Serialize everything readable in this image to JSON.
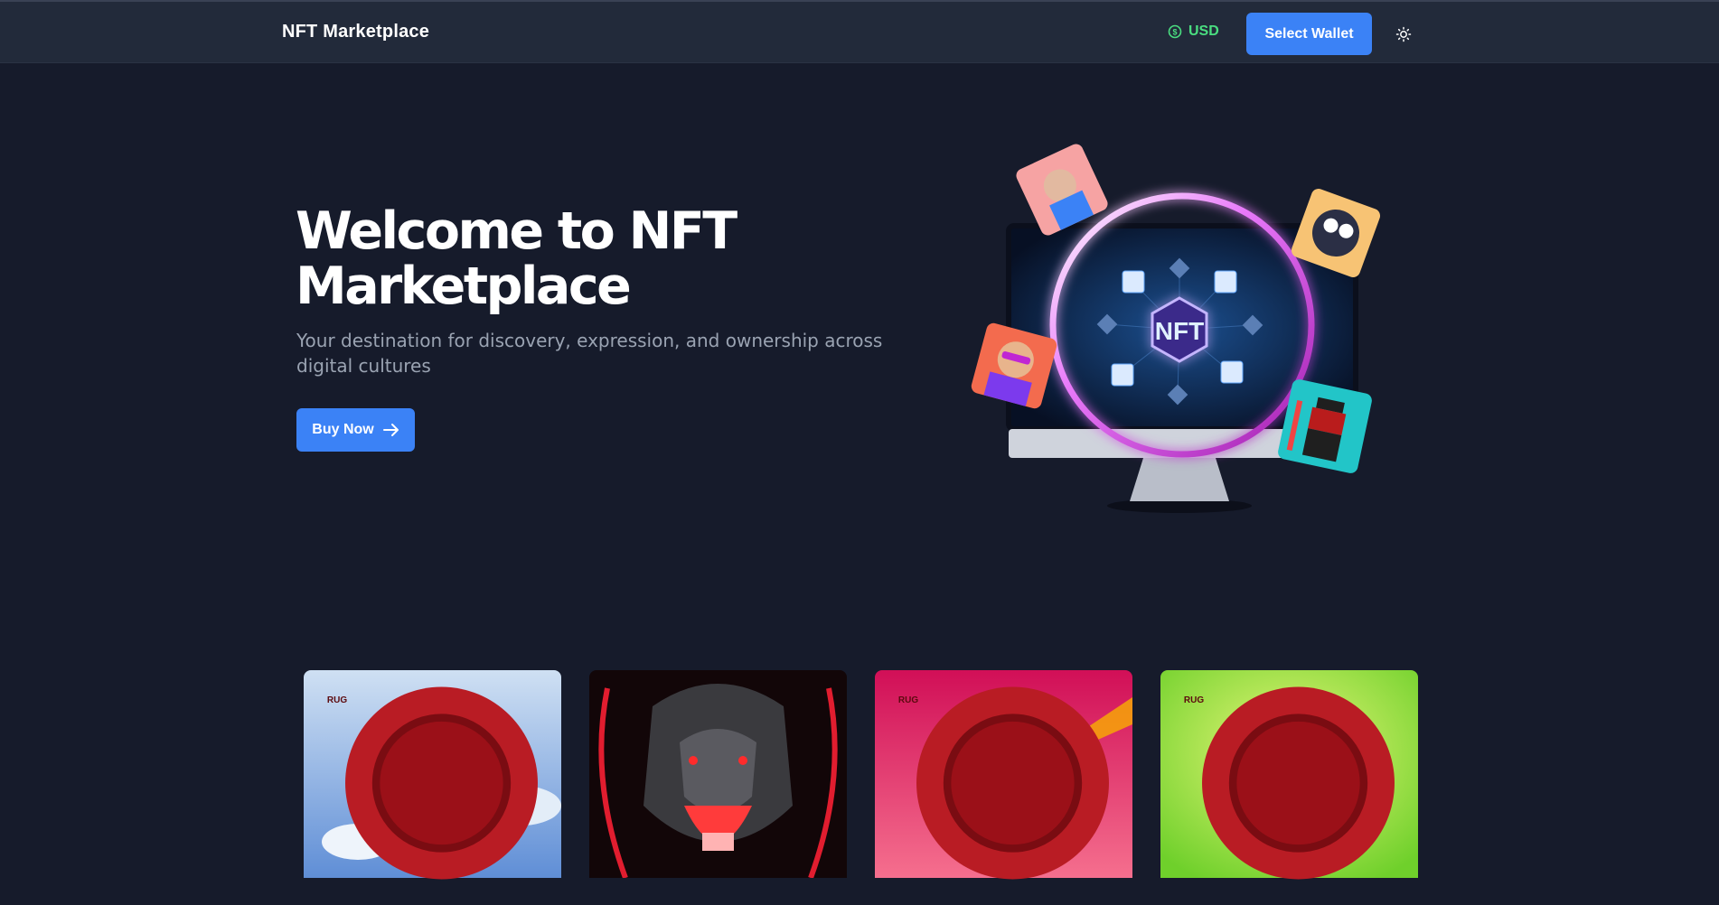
{
  "nav": {
    "brand": "NFT Marketplace",
    "currency": "USD",
    "wallet_button": "Select Wallet",
    "theme_icon": "sun-icon"
  },
  "hero": {
    "title": "Welcome to NFT Marketplace",
    "subtitle": "Your destination for discovery, expression, and ownership across digital cultures",
    "cta": "Buy Now",
    "art_center_text": "NFT"
  },
  "cards": [
    {
      "seal": "RUG",
      "theme": "blue-sky-skull"
    },
    {
      "seal": "",
      "theme": "red-bear"
    },
    {
      "seal": "RUG",
      "theme": "pink-joker-skull"
    },
    {
      "seal": "RUG",
      "theme": "lime-halo-skull"
    }
  ],
  "colors": {
    "background": "#161b2b",
    "navbar": "#222a3a",
    "accent": "#3b82f6",
    "currency": "#4ade80",
    "muted_text": "#9aa3b2"
  }
}
